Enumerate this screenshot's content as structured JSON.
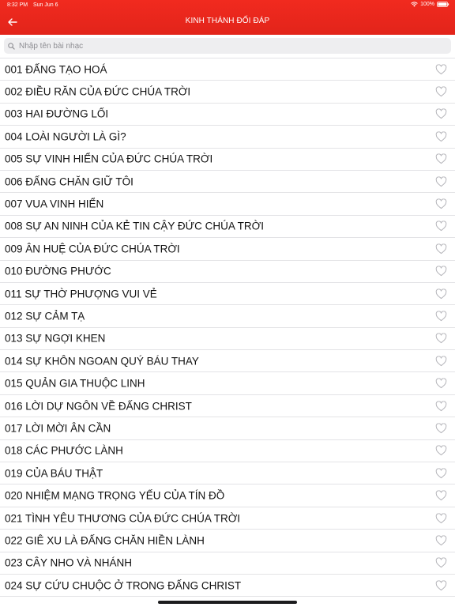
{
  "status_bar": {
    "time": "8:32 PM",
    "date": "Sun Jun 6",
    "battery": "100%"
  },
  "nav": {
    "title": "KINH THÁNH ĐỐI ĐÁP",
    "back_icon": "arrow-left-icon"
  },
  "search": {
    "placeholder": "Nhập tên bài nhạc",
    "value": ""
  },
  "colors": {
    "header": "#e8271c",
    "text": "#111111",
    "icon": "#b3b3b8"
  },
  "items": [
    {
      "label": "001 ĐẤNG TẠO HOÁ"
    },
    {
      "label": "002 ĐIỀU RĂN CỦA ĐỨC CHÚA TRỜI"
    },
    {
      "label": "003 HAI ĐƯỜNG LỐI"
    },
    {
      "label": "004 LOÀI NGƯỜI LÀ GÌ?"
    },
    {
      "label": "005 SỰ VINH HIỂN CỦA ĐỨC CHÚA TRỜI"
    },
    {
      "label": "006 ĐẤNG CHĂN GIỮ TÔI"
    },
    {
      "label": "007 VUA VINH HIỂN"
    },
    {
      "label": "008 SỰ AN NINH CỦA KẺ TIN CẬY ĐỨC CHÚA TRỜI"
    },
    {
      "label": "009 ÂN HUỆ CỦA ĐỨC CHÚA TRỜI"
    },
    {
      "label": "010 ĐƯỜNG PHƯỚC"
    },
    {
      "label": "011 SỰ THỜ PHƯỢNG VUI VẺ"
    },
    {
      "label": "012 SỰ CẢM TẠ"
    },
    {
      "label": "013 SỰ NGỢI KHEN"
    },
    {
      "label": "014 SỰ KHÔN NGOAN QUÝ BÁU THAY"
    },
    {
      "label": "015 QUẢN GIA THUỘC LINH"
    },
    {
      "label": "016 LỜI DỰ NGÔN VỀ ĐẤNG CHRIST"
    },
    {
      "label": "017 LỜI MỜI ÂN CẦN"
    },
    {
      "label": "018 CÁC PHƯỚC LÀNH"
    },
    {
      "label": "019 CỦA BÁU THẬT"
    },
    {
      "label": "020 NHIỆM MẠNG TRỌNG YẾU CỦA TÍN ĐỒ"
    },
    {
      "label": "021 TÌNH YÊU THƯƠNG CỦA ĐỨC CHÚA TRỜI"
    },
    {
      "label": "022 GIÊ XU LÀ ĐẤNG CHĂN HIỀN LÀNH"
    },
    {
      "label": "023 CÂY NHO VÀ NHÁNH"
    },
    {
      "label": "024 SỰ CỨU CHUỘC Ở TRONG ĐẤNG CHRIST"
    }
  ]
}
